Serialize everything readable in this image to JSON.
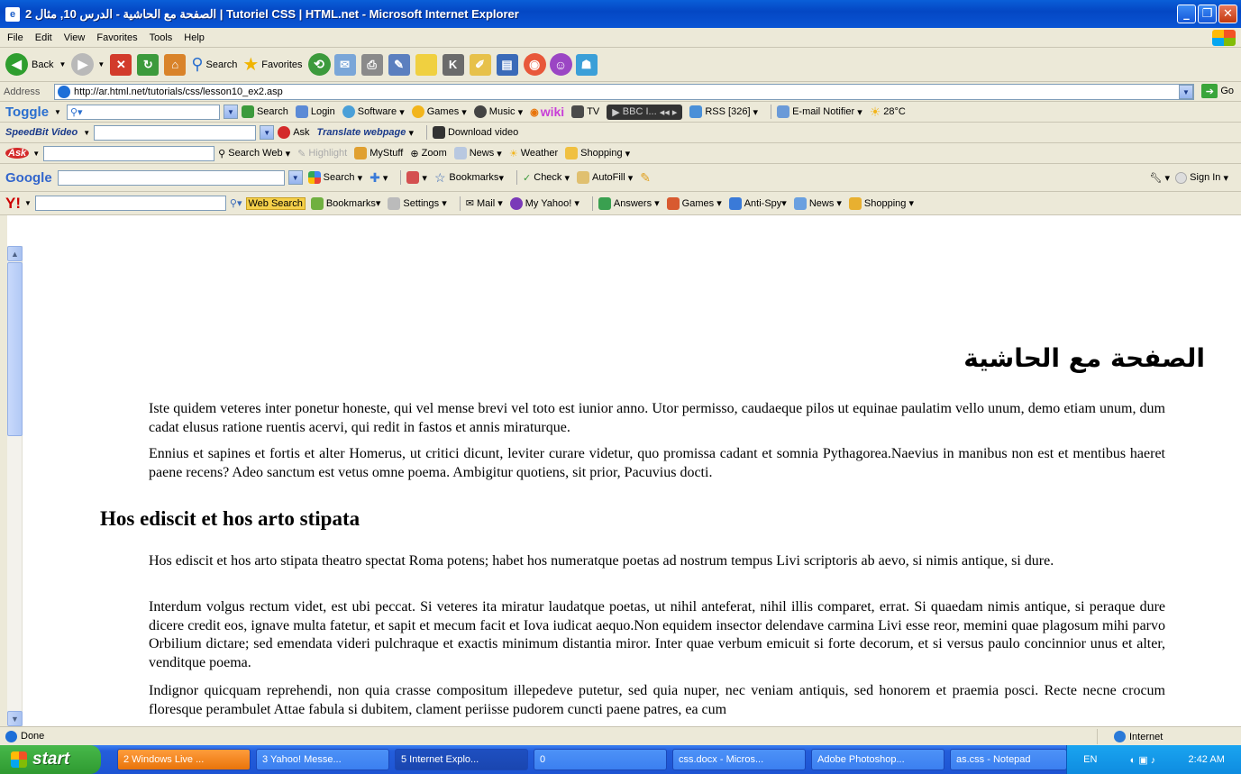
{
  "window": {
    "title": "الصفحة مع الحاشية - الدرس 10, مثال 2 | Tutoriel CSS | HTML.net - Microsoft Internet Explorer"
  },
  "menu": [
    "File",
    "Edit",
    "View",
    "Favorites",
    "Tools",
    "Help"
  ],
  "std": {
    "back": "Back",
    "search": "Search",
    "favorites": "Favorites"
  },
  "address": {
    "label": "Address",
    "url": "http://ar.html.net/tutorials/css/lesson10_ex2.asp",
    "go": "Go"
  },
  "toggle": {
    "name": "Toggle",
    "search": "Search",
    "login": "Login",
    "software": "Software",
    "games": "Games",
    "music": "Music",
    "wiki": "wiki",
    "tv": "TV",
    "bbc": "BBC I...",
    "rss": "RSS [326]",
    "email": "E-mail Notifier",
    "temp": "28°C"
  },
  "speedbit": {
    "name": "SpeedBit Video",
    "ask": "Ask",
    "translate": "Translate webpage",
    "download": "Download video"
  },
  "askbar": {
    "search": "Search Web",
    "highlight": "Highlight",
    "mystuff": "MyStuff",
    "zoom": "Zoom",
    "news": "News",
    "weather": "Weather",
    "shopping": "Shopping"
  },
  "google": {
    "name": "Google",
    "search": "Search",
    "bookmarks": "Bookmarks",
    "check": "Check",
    "autofill": "AutoFill",
    "signin": "Sign In"
  },
  "yahoo": {
    "name": "Y!",
    "websearch": "Web Search",
    "bookmarks": "Bookmarks",
    "settings": "Settings",
    "mail": "Mail",
    "myyahoo": "My Yahoo!",
    "answers": "Answers",
    "games": "Games",
    "antispy": "Anti-Spy",
    "news": "News",
    "shopping": "Shopping"
  },
  "page": {
    "heading_ar": "الصفحة مع الحاشية",
    "p1": "Iste quidem veteres inter ponetur honeste, qui vel mense brevi vel toto est iunior anno. Utor permisso, caudaeque pilos ut equinae paulatim vello unum, demo etiam unum, dum cadat elusus ratione ruentis acervi, qui redit in fastos et annis miraturque.",
    "p2": "Ennius et sapines et fortis et alter Homerus, ut critici dicunt, leviter curare videtur, quo promissa cadant et somnia Pythagorea.Naevius in manibus non est et mentibus haeret paene recens? Adeo sanctum est vetus omne poema. Ambigitur quotiens, sit prior, Pacuvius docti.",
    "h2": "Hos ediscit et hos arto stipata",
    "p3": "Hos ediscit et hos arto stipata theatro spectat Roma potens; habet hos numeratque poetas ad nostrum tempus Livi scriptoris ab aevo, si nimis antique, si dure.",
    "p4": "Interdum volgus rectum videt, est ubi peccat. Si veteres ita miratur laudatque poetas, ut nihil anteferat, nihil illis comparet, errat. Si quaedam nimis antique, si peraque dure dicere credit eos, ignave multa fatetur, et sapit et mecum facit et Iova iudicat aequo.Non equidem insector delendave carmina Livi esse reor, memini quae plagosum mihi parvo Orbilium dictare; sed emendata videri pulchraque et exactis minimum distantia miror. Inter quae verbum emicuit si forte decorum, et si versus paulo concinnior unus et alter, venditque poema.",
    "p5": "Indignor quicquam reprehendi, non quia crasse compositum illepedeve putetur, sed quia nuper, nec veniam antiquis, sed honorem et praemia posci. Recte necne crocum floresque perambulet Attae fabula si dubitem, clament periisse pudorem cuncti paene patres, ea cum"
  },
  "status": {
    "text": "Done",
    "zone": "Internet"
  },
  "taskbar": {
    "start": "start",
    "tasks": [
      "2 Windows Live ...",
      "3 Yahoo! Messe...",
      "5 Internet Explo...",
      "0",
      "css.docx - Micros...",
      "Adobe Photoshop...",
      "as.css - Notepad"
    ],
    "lang": "EN",
    "time": "2:42 AM"
  }
}
